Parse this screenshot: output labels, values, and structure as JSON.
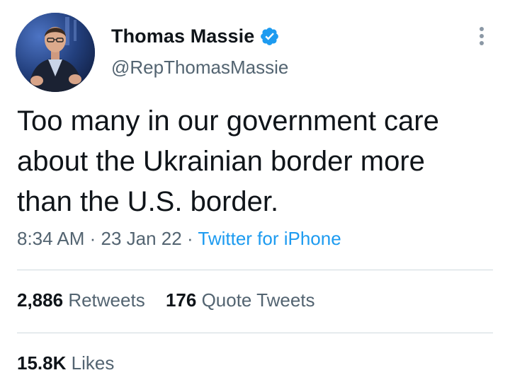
{
  "author": {
    "display_name": "Thomas Massie",
    "handle": "@RepThomasMassie",
    "verified": true,
    "avatar_icon": "profile-photo"
  },
  "tweet": {
    "lines": [
      "Too many in our government care",
      "about the Ukrainian border more",
      "than the U.S. border."
    ],
    "time": "8:34 AM",
    "separator": " · ",
    "date": "23 Jan 22",
    "source": "Twitter for iPhone"
  },
  "stats": {
    "retweets_count": "2,886",
    "retweets_label": "Retweets",
    "quotes_count": "176",
    "quotes_label": "Quote Tweets",
    "likes_count": "15.8K",
    "likes_label": "Likes"
  },
  "colors": {
    "text": "#0f1419",
    "secondary": "#536471",
    "accent": "#1d9bf0",
    "divider": "#cfd9de"
  }
}
